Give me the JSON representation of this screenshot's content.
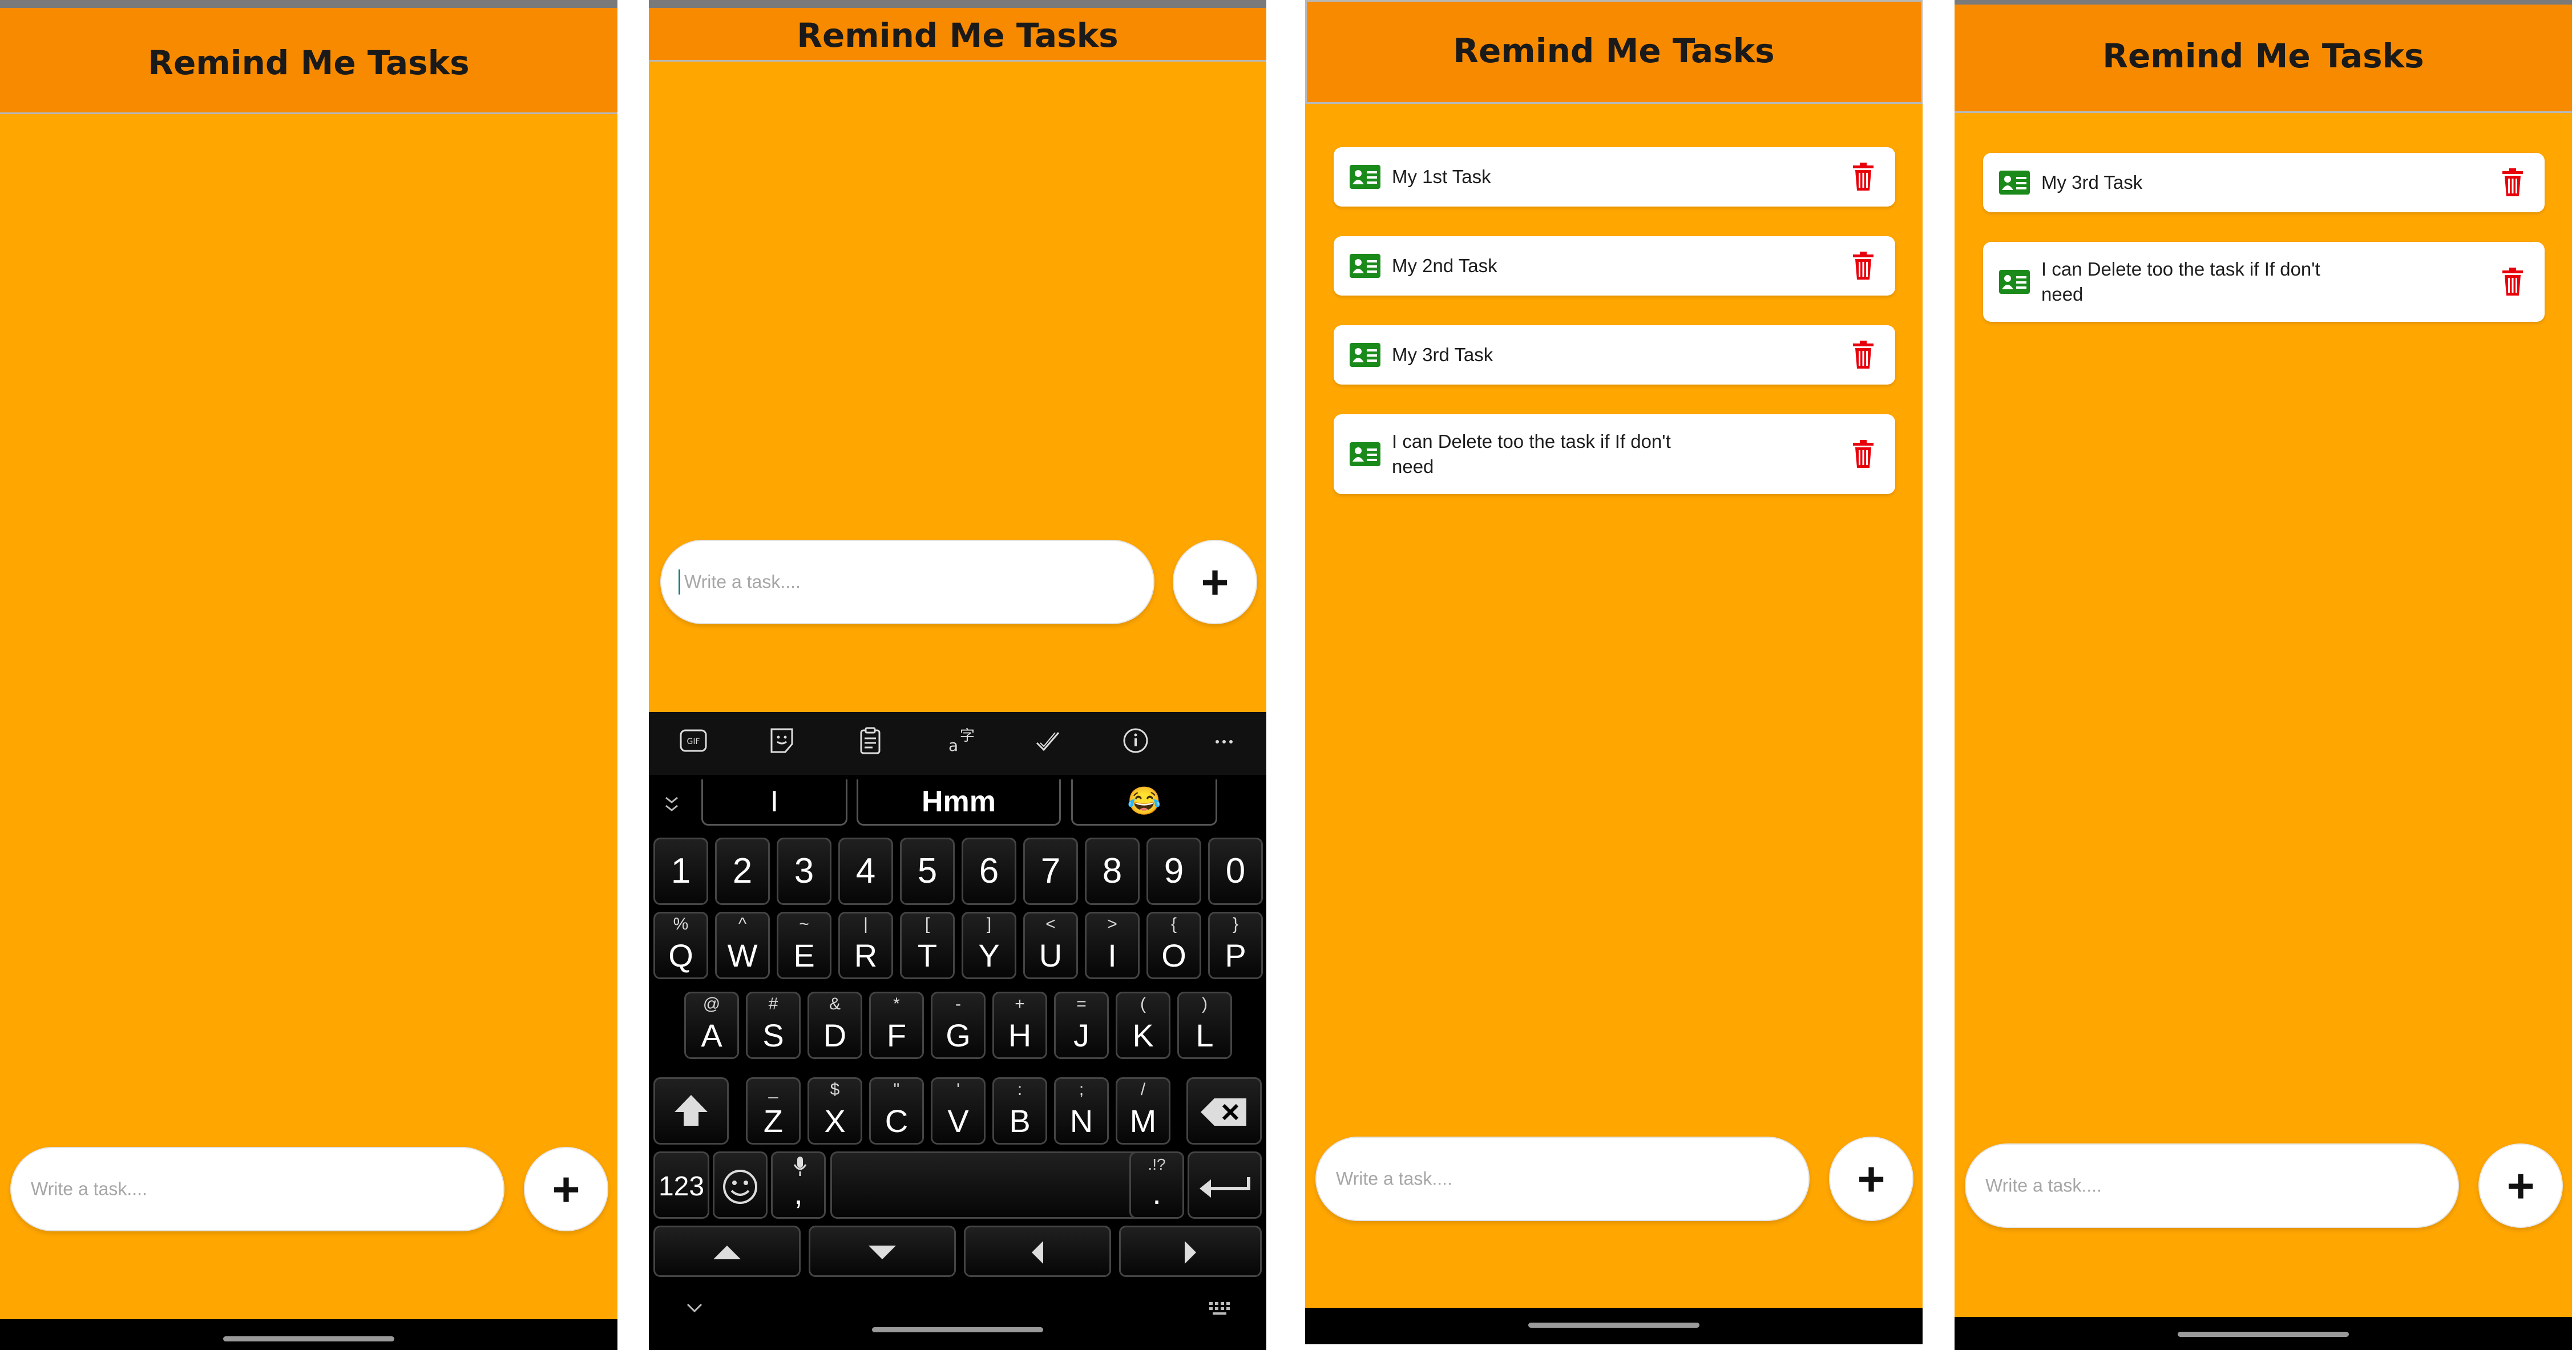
{
  "app": {
    "title": "Remind Me Tasks",
    "input_placeholder": "Write a task....",
    "add_label": "+"
  },
  "colors": {
    "header": "#f88a00",
    "body": "#ffa600",
    "task_icon": "#1a8a1a",
    "trash_icon": "#e8000b"
  },
  "screens": [
    {
      "tasks": []
    },
    {
      "tasks": []
    },
    {
      "tasks": [
        {
          "text": "My 1st Task"
        },
        {
          "text": "My 2nd Task"
        },
        {
          "text": "My 3rd Task"
        },
        {
          "text": "I can Delete too the task if If don't need"
        }
      ]
    },
    {
      "tasks": [
        {
          "text": "My 3rd Task"
        },
        {
          "text": "I can Delete too the task if If don't need"
        }
      ]
    }
  ],
  "keyboard": {
    "toolbar_icons": [
      "gif-icon",
      "sticker-icon",
      "clipboard-icon",
      "translate-icon",
      "spellcheck-icon",
      "info-icon",
      "more-icon"
    ],
    "suggestions": [
      "I",
      "Hmm",
      "😂"
    ],
    "number_row": [
      "1",
      "2",
      "3",
      "4",
      "5",
      "6",
      "7",
      "8",
      "9",
      "0"
    ],
    "row1": [
      [
        "%",
        "Q"
      ],
      [
        "^",
        "W"
      ],
      [
        "~",
        "E"
      ],
      [
        "|",
        "R"
      ],
      [
        "[",
        "T"
      ],
      [
        "]",
        "Y"
      ],
      [
        "<",
        "U"
      ],
      [
        ">",
        "I"
      ],
      [
        "{",
        "O"
      ],
      [
        "}",
        "P"
      ]
    ],
    "row2": [
      [
        "@",
        "A"
      ],
      [
        "#",
        "S"
      ],
      [
        "&",
        "D"
      ],
      [
        "*",
        "F"
      ],
      [
        "-",
        "G"
      ],
      [
        "+",
        "H"
      ],
      [
        "=",
        "J"
      ],
      [
        "(",
        "K"
      ],
      [
        ")",
        "L"
      ]
    ],
    "row3": [
      [
        "_",
        "Z"
      ],
      [
        "$",
        "X"
      ],
      [
        "\"",
        "C"
      ],
      [
        "'",
        "V"
      ],
      [
        ":",
        "B"
      ],
      [
        ";",
        "N"
      ],
      [
        "/",
        "M"
      ]
    ],
    "symbols_label": "123",
    "comma_label": ",",
    "period_label": ".",
    "period_alt": ".!?"
  }
}
